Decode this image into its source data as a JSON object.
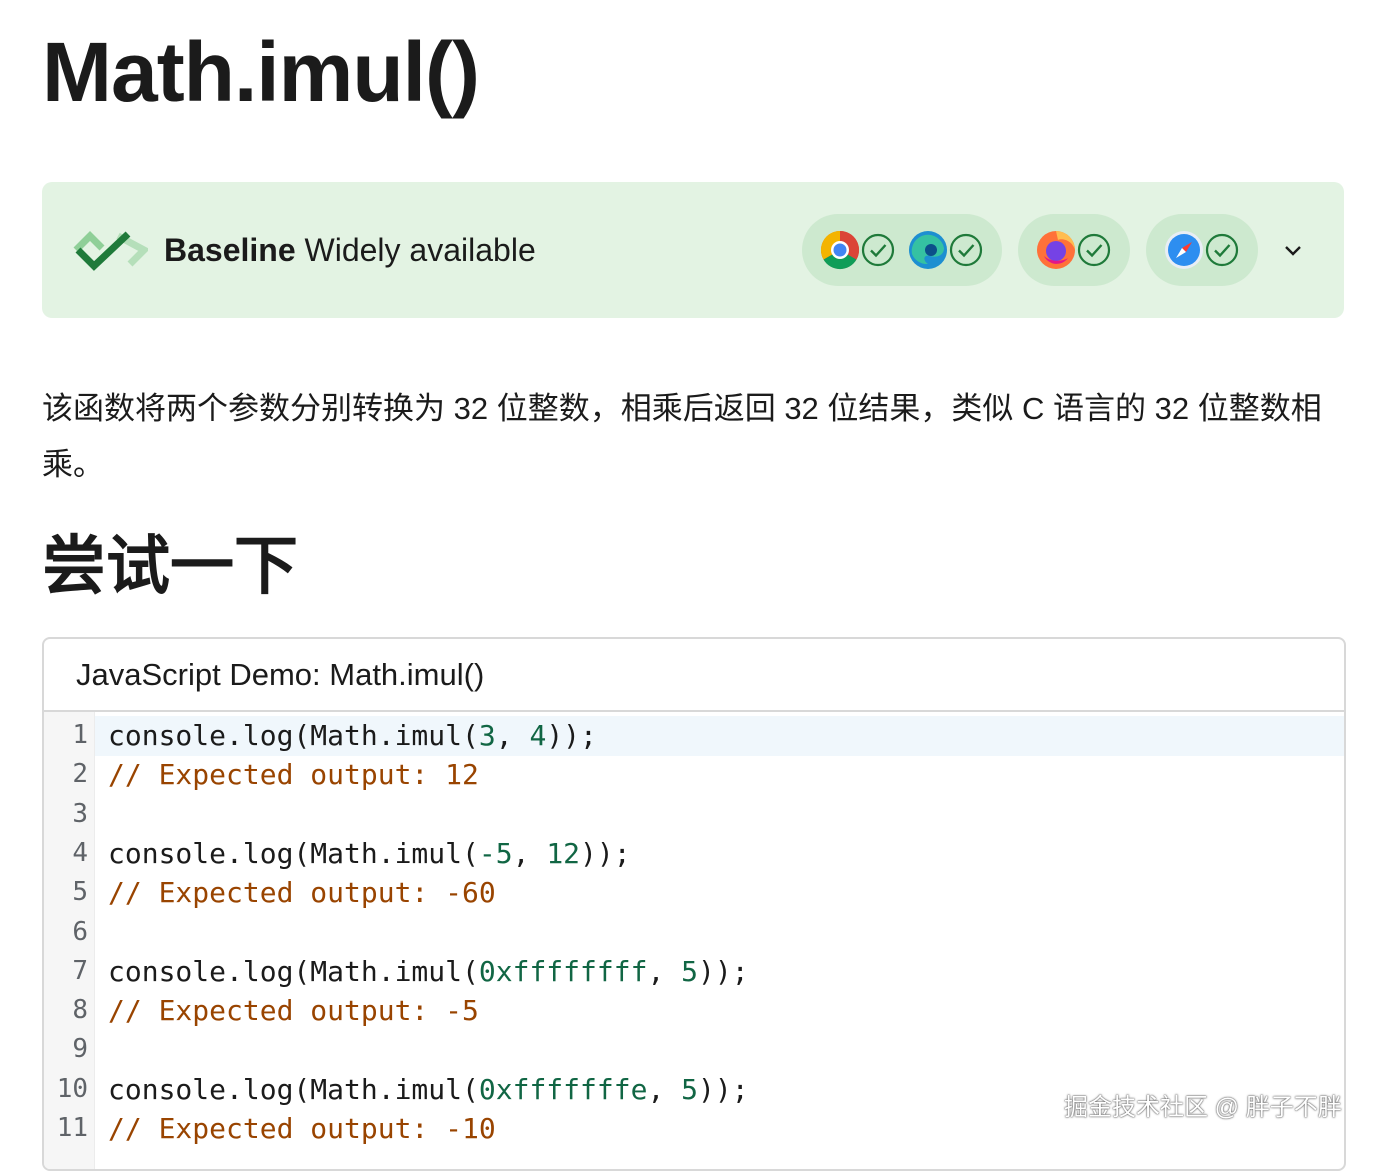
{
  "page": {
    "title": "Math.imul()"
  },
  "baseline": {
    "label_bold": "Baseline",
    "label_rest": " Widely available",
    "browsers": [
      {
        "name": "chrome-icon",
        "supported": true
      },
      {
        "name": "edge-icon",
        "supported": true
      },
      {
        "name": "firefox-icon",
        "supported": true
      },
      {
        "name": "safari-icon",
        "supported": true
      }
    ],
    "accent_color": "#1f7a3a",
    "background_color": "#e3f3e3",
    "pill_color": "#cde9cf"
  },
  "description": "该函数将两个参数分别转换为 32 位整数，相乘后返回 32 位结果，类似 C 语言的 32 位整数相乘。",
  "try_section": {
    "heading": "尝试一下"
  },
  "demo": {
    "title": "JavaScript Demo: Math.imul()",
    "lines": [
      {
        "n": "1",
        "code": [
          {
            "t": "console.log(Math.imul(",
            "c": "plain"
          },
          {
            "t": "3",
            "c": "num"
          },
          {
            "t": ", ",
            "c": "plain"
          },
          {
            "t": "4",
            "c": "num"
          },
          {
            "t": "));",
            "c": "plain"
          }
        ]
      },
      {
        "n": "2",
        "code": [
          {
            "t": "// Expected output: 12",
            "c": "comment"
          }
        ]
      },
      {
        "n": "3",
        "code": []
      },
      {
        "n": "4",
        "code": [
          {
            "t": "console.log(Math.imul(",
            "c": "plain"
          },
          {
            "t": "-5",
            "c": "num"
          },
          {
            "t": ", ",
            "c": "plain"
          },
          {
            "t": "12",
            "c": "num"
          },
          {
            "t": "));",
            "c": "plain"
          }
        ]
      },
      {
        "n": "5",
        "code": [
          {
            "t": "// Expected output: -60",
            "c": "comment"
          }
        ]
      },
      {
        "n": "6",
        "code": []
      },
      {
        "n": "7",
        "code": [
          {
            "t": "console.log(Math.imul(",
            "c": "plain"
          },
          {
            "t": "0xffffffff",
            "c": "num"
          },
          {
            "t": ", ",
            "c": "plain"
          },
          {
            "t": "5",
            "c": "num"
          },
          {
            "t": "));",
            "c": "plain"
          }
        ]
      },
      {
        "n": "8",
        "code": [
          {
            "t": "// Expected output: -5",
            "c": "comment"
          }
        ]
      },
      {
        "n": "9",
        "code": []
      },
      {
        "n": "10",
        "code": [
          {
            "t": "console.log(Math.imul(",
            "c": "plain"
          },
          {
            "t": "0xfffffffe",
            "c": "num"
          },
          {
            "t": ", ",
            "c": "plain"
          },
          {
            "t": "5",
            "c": "num"
          },
          {
            "t": "));",
            "c": "plain"
          }
        ]
      },
      {
        "n": "11",
        "code": [
          {
            "t": "// Expected output: -10",
            "c": "comment"
          }
        ]
      }
    ],
    "colors": {
      "number": "#116644",
      "comment": "#994400"
    }
  },
  "watermark": "掘金技术社区 @ 胖子不胖"
}
